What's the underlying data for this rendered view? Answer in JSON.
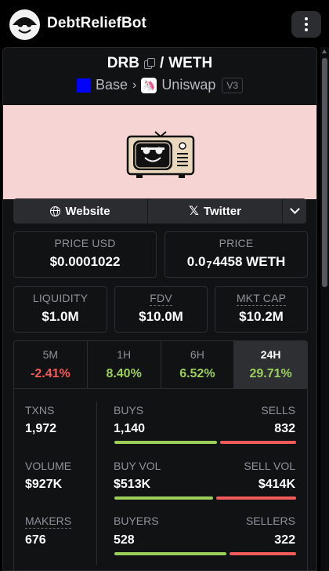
{
  "app": {
    "title": "DebtReliefBot"
  },
  "pair": {
    "base": "DRB",
    "separator": "/",
    "quote": "WETH"
  },
  "chain": {
    "name": "Base",
    "dex": "Uniswap",
    "version": "V3",
    "chain_color": "#0000ff"
  },
  "links": {
    "website": "Website",
    "twitter": "Twitter"
  },
  "prices": {
    "usd_label": "PRICE USD",
    "usd_value": "$0.0001022",
    "native_label": "PRICE",
    "native_lead": "0.0",
    "native_zeros": "7",
    "native_tail": "4458 WETH"
  },
  "metrics": {
    "liquidity_label": "LIQUIDITY",
    "liquidity_value": "$1.0M",
    "fdv_label": "FDV",
    "fdv_value": "$10.0M",
    "mcap_label": "MKT CAP",
    "mcap_value": "$10.2M"
  },
  "timeframes": [
    {
      "label": "5M",
      "change": "-2.41%"
    },
    {
      "label": "1H",
      "change": "8.40%"
    },
    {
      "label": "6H",
      "change": "6.52%"
    },
    {
      "label": "24H",
      "change": "29.71%"
    }
  ],
  "stats": {
    "txns_label": "TXNS",
    "txns_value": "1,972",
    "buys_label": "BUYS",
    "buys_value": "1,140",
    "sells_label": "SELLS",
    "sells_value": "832",
    "volume_label": "VOLUME",
    "volume_value": "$927K",
    "buy_vol_label": "BUY VOL",
    "buy_vol_value": "$513K",
    "sell_vol_label": "SELL VOL",
    "sell_vol_value": "$414K",
    "makers_label": "MAKERS",
    "makers_value": "676",
    "buyers_label": "BUYERS",
    "buyers_value": "528",
    "sellers_label": "SELLERS",
    "sellers_value": "322"
  },
  "colors": {
    "positive": "#9bcf5a",
    "negative": "#f35a5a",
    "banner": "#f6d4d4"
  }
}
